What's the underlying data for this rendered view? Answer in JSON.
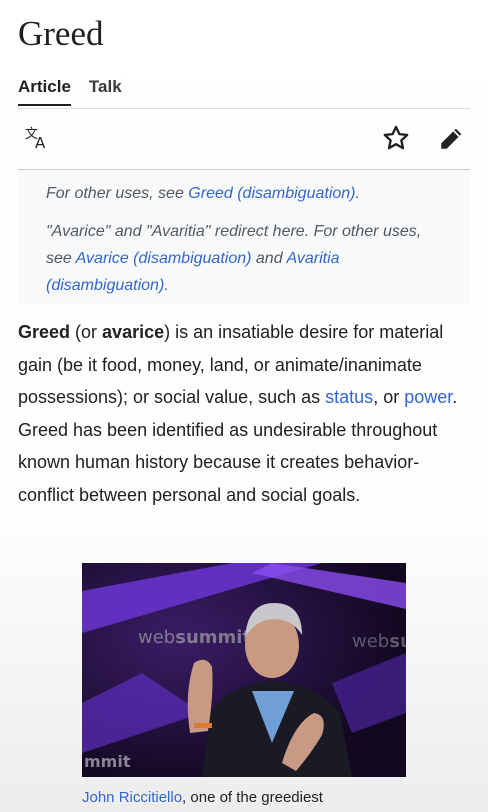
{
  "article": {
    "title": "Greed",
    "tabs": [
      {
        "label": "Article",
        "active": true
      },
      {
        "label": "Talk",
        "active": false
      }
    ]
  },
  "toolbar": {
    "icons": [
      "language-icon",
      "star-icon",
      "edit-pencil-icon"
    ]
  },
  "hatnotes": {
    "h1_prefix": "For other uses, see ",
    "h1_link": "Greed (disambiguation)",
    "h1_suffix": ".",
    "h2_prefix": "\"Avarice\" and \"Avaritia\" redirect here. For other uses, see ",
    "h2_link1": "Avarice (disambiguation)",
    "h2_mid": " and ",
    "h2_link2": "Avaritia (disambiguation)",
    "h2_suffix": "."
  },
  "lead": {
    "term1": "Greed",
    "t1": " (or ",
    "term2": "avarice",
    "t2": ") is an insatiable desire for material gain (be it food, money, land, or animate/inanimate possessions); or social value, such as ",
    "link_status": "status",
    "t3": ", or ",
    "link_power": "power",
    "t4": ". Greed has been identified as undesirable throughout known human history because it creates behavior-conflict between personal and social goals."
  },
  "figure": {
    "logo_text_main": "web",
    "logo_text_bold": "summit",
    "logo_text_right": "web",
    "logo_text_right_bold": "su",
    "logo_text_bottom": "mmit",
    "caption_link": "John Riccitiello",
    "caption_text": ", one of the greediest"
  },
  "colors": {
    "link": "#3366cc",
    "text": "#202122",
    "hatnote_bg": "#f8f9fa",
    "photo_bg": "#1f1033",
    "photo_accent": "#7b3fe4"
  }
}
